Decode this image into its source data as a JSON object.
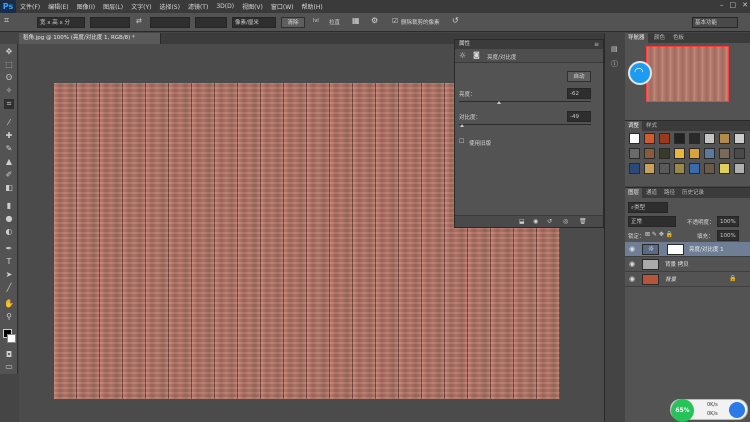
{
  "app": {
    "logo": "Ps"
  },
  "menu": [
    "文件(F)",
    "编辑(E)",
    "图像(I)",
    "图层(L)",
    "文字(Y)",
    "选择(S)",
    "滤镜(T)",
    "3D(D)",
    "视图(V)",
    "窗口(W)",
    "帮助(H)"
  ],
  "options": {
    "ratio": "宽 x 高 x 分",
    "unit": "像素/厘米",
    "clear": "清除",
    "straighten": "拉直",
    "delete_crop": "删除裁剪的像素",
    "workspace": "基本功能"
  },
  "document": {
    "tab": "稻角.jpg @ 100% (亮度/对比度 1, RGB/8) *"
  },
  "properties": {
    "title": "属性",
    "adj_name": "亮度/对比度",
    "auto": "自动",
    "brightness_label": "亮度：",
    "brightness_value": "-62",
    "brightness_level": 0.3,
    "contrast_label": "对比度：",
    "contrast_value": "-49",
    "contrast_level": 0.02,
    "legacy": "使用旧版"
  },
  "navigator": {
    "tabs": [
      "导航器",
      "颜色",
      "色板"
    ]
  },
  "adjustments": {
    "tabs": [
      "调整",
      "样式"
    ]
  },
  "layers": {
    "tabs": [
      "图层",
      "通道",
      "路径",
      "历史记录"
    ],
    "kind": "类型",
    "blend": "正常",
    "opacity_label": "不透明度：",
    "opacity": "100%",
    "lock_label": "锁定：",
    "fill_label": "填充：",
    "fill": "100%",
    "items": [
      {
        "name": "亮度/对比度 1",
        "active": true
      },
      {
        "name": "背景 拷贝",
        "active": false
      },
      {
        "name": "背景",
        "active": false
      }
    ]
  },
  "widget": {
    "percent": "65%",
    "up": "0K/s",
    "down": "0K/s"
  },
  "colors": {
    "accent": "#1d9bf0",
    "active_layer": "#6e7e94",
    "green": "#28c25b"
  }
}
